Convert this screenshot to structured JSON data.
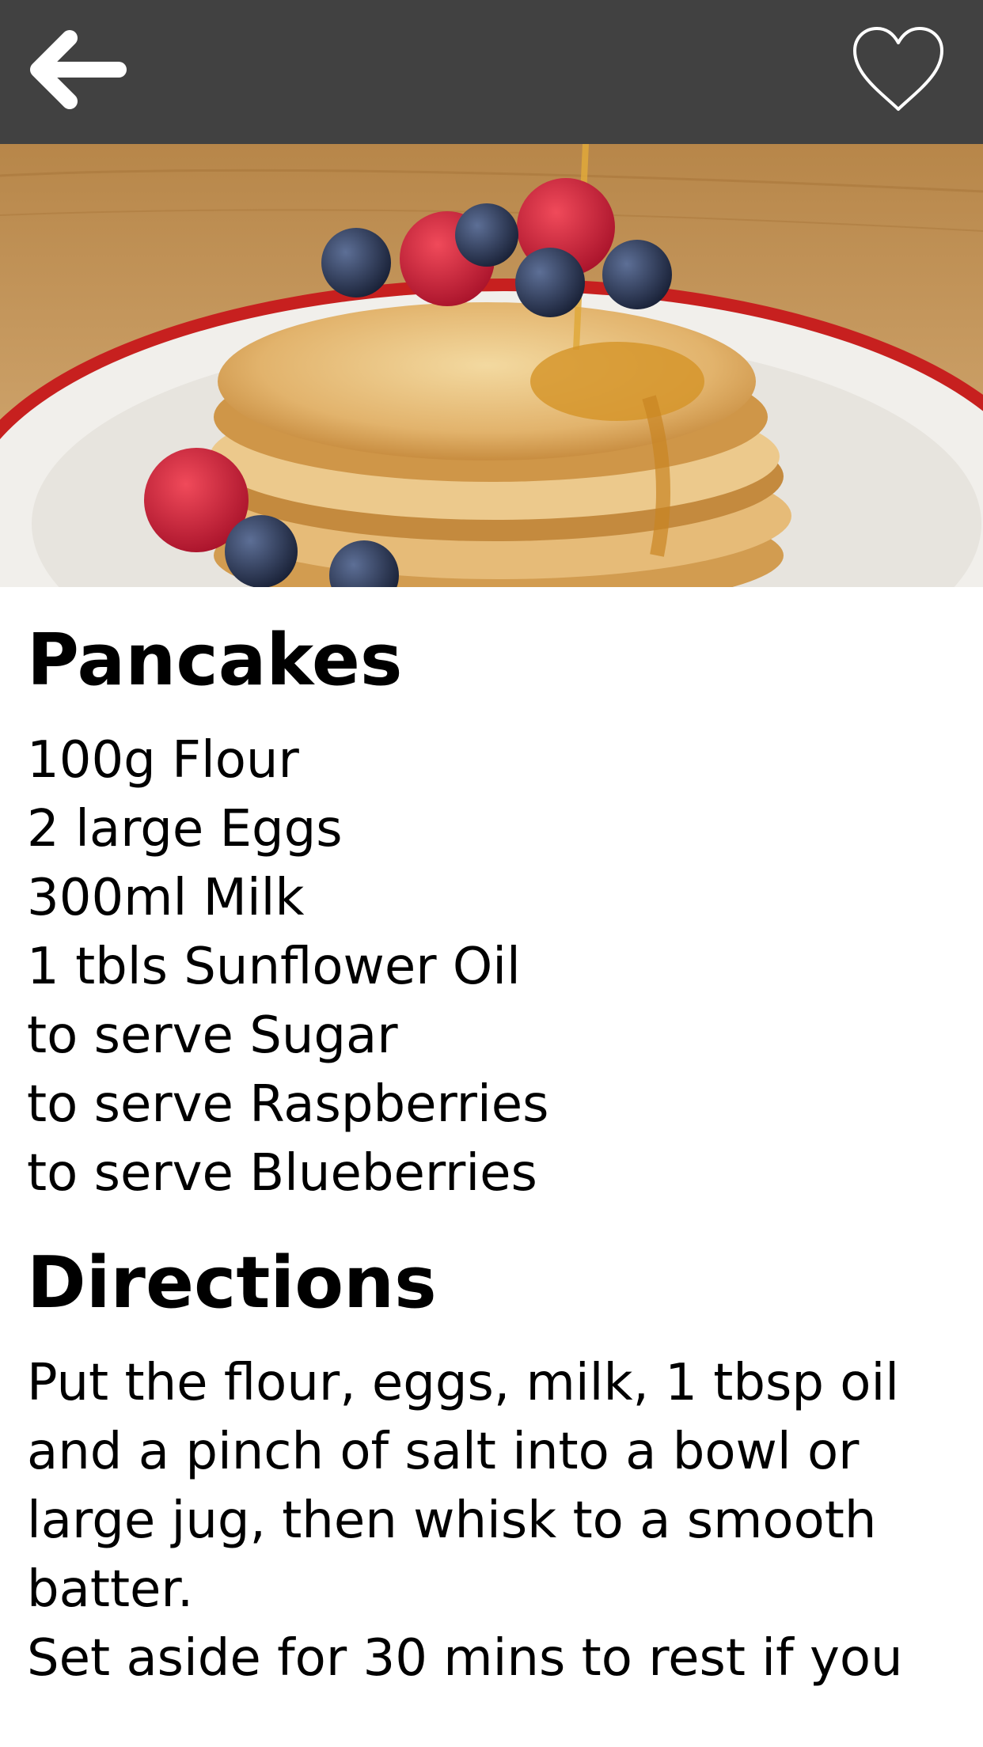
{
  "header": {
    "back_icon": "back-arrow-icon",
    "favorite_icon": "heart-outline-icon",
    "background_color": "#414141"
  },
  "hero": {
    "image_subject": "stack of pancakes with raspberries, blueberries and syrup on a red-rimmed plate"
  },
  "recipe": {
    "title": "Pancakes",
    "ingredients": [
      "100g Flour",
      "2 large Eggs",
      "300ml Milk",
      "1 tbls Sunflower Oil",
      "to serve Sugar",
      "to serve Raspberries",
      "to serve Blueberries"
    ],
    "directions_heading": "Directions",
    "directions": [
      "Put the flour, eggs, milk, 1 tbsp oil and a pinch of salt into a bowl or large jug, then whisk to a smooth batter.",
      "Set aside for 30 mins to rest if you"
    ]
  }
}
